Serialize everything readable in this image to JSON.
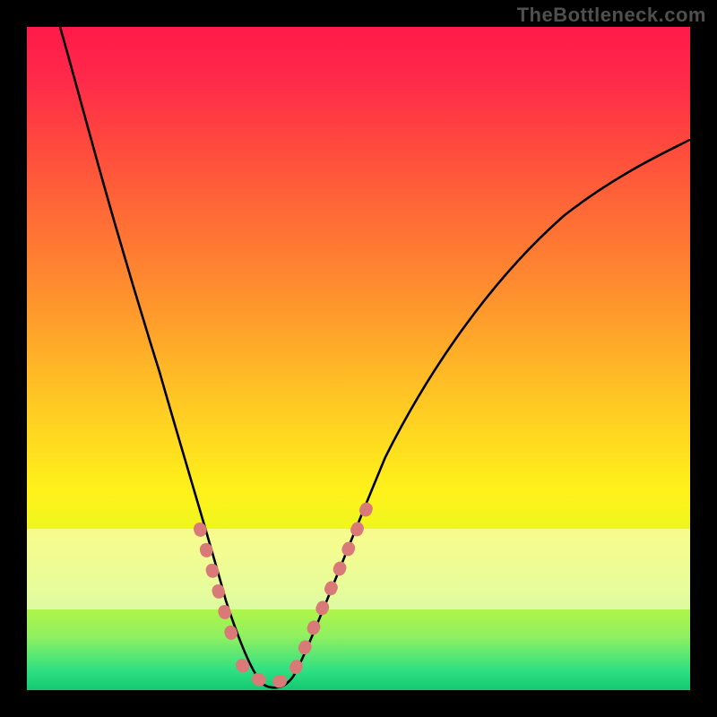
{
  "watermark": "TheBottleneck.com",
  "chart_data": {
    "type": "line",
    "title": "",
    "xlabel": "",
    "ylabel": "",
    "xlim": [
      0,
      100
    ],
    "ylim": [
      0,
      100
    ],
    "grid": false,
    "legend": false,
    "background_gradient": {
      "direction": "vertical",
      "stops": [
        {
          "pos": 0.0,
          "color": "#ff1a4a"
        },
        {
          "pos": 0.3,
          "color": "#ff7a30"
        },
        {
          "pos": 0.55,
          "color": "#ffc824"
        },
        {
          "pos": 0.75,
          "color": "#fff21a"
        },
        {
          "pos": 0.9,
          "color": "#a8f050"
        },
        {
          "pos": 1.0,
          "color": "#13c971"
        }
      ]
    },
    "annotations": [
      {
        "kind": "horizontal-band",
        "y_from": 12,
        "y_to": 24,
        "note": "pale-yellow overlay band"
      }
    ],
    "series": [
      {
        "name": "bottleneck-curve",
        "color": "#000000",
        "x": [
          5,
          10,
          15,
          20,
          25,
          27,
          30,
          33,
          36,
          38,
          40,
          45,
          50,
          55,
          60,
          70,
          80,
          90,
          100
        ],
        "y": [
          100,
          86,
          70,
          52,
          34,
          24,
          12,
          4,
          0,
          0,
          2,
          8,
          18,
          28,
          36,
          50,
          62,
          72,
          78
        ]
      }
    ],
    "markers": [
      {
        "name": "left-branch-dots",
        "color": "#d97a78",
        "along_series": "bottleneck-curve",
        "x_from": 25,
        "x_to": 32,
        "note": "salmon dotted markers on descending branch near bottom"
      },
      {
        "name": "valley-dots",
        "color": "#d97a78",
        "along_series": "bottleneck-curve",
        "x_from": 33,
        "x_to": 40,
        "note": "salmon dotted markers across valley floor"
      },
      {
        "name": "right-branch-dots",
        "color": "#d97a78",
        "along_series": "bottleneck-curve",
        "x_from": 40,
        "x_to": 50,
        "note": "salmon dotted markers on ascending branch near bottom"
      }
    ]
  }
}
